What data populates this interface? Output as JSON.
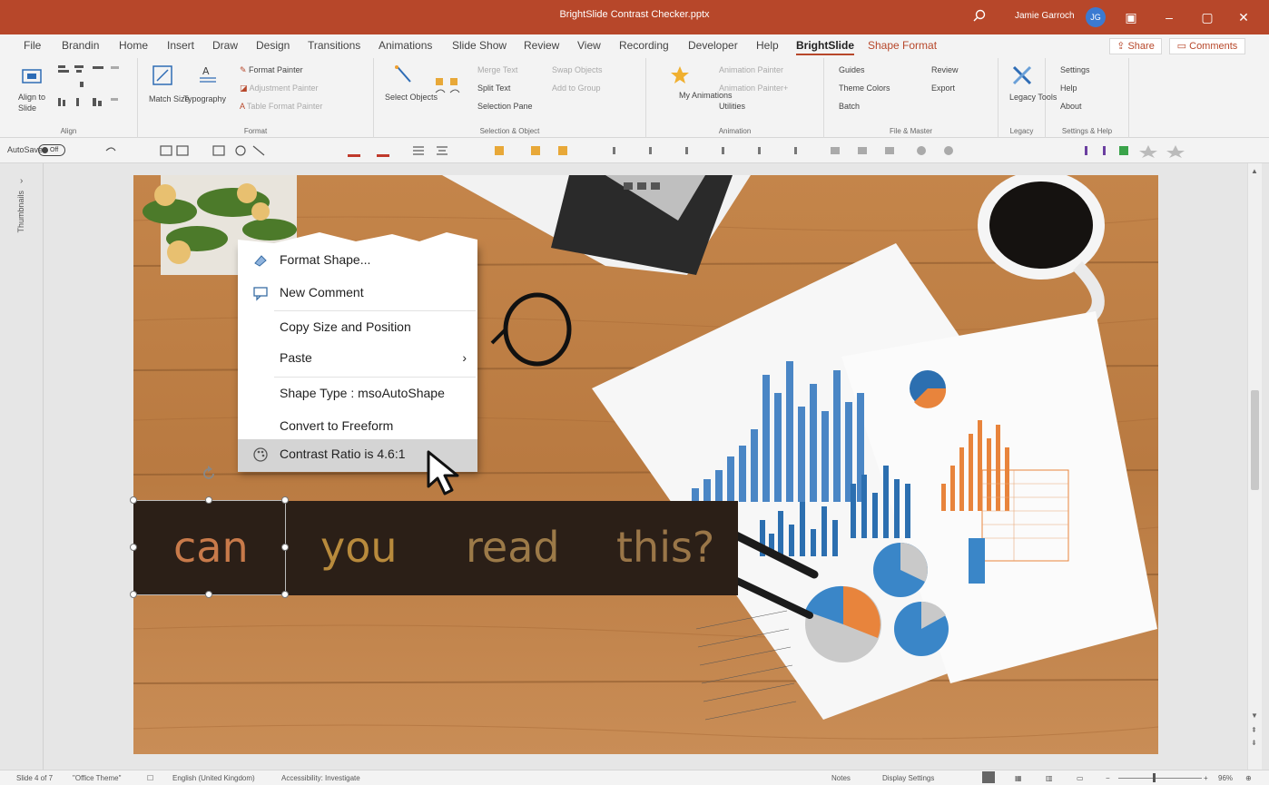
{
  "app": {
    "title": "BrightSlide Contrast Checker.pptx",
    "user_name": "Jamie Garroch",
    "user_initials": "JG"
  },
  "menu": {
    "tabs": [
      "File",
      "Brandin",
      "Home",
      "Insert",
      "Draw",
      "Design",
      "Transitions",
      "Animations",
      "Slide Show",
      "Review",
      "View",
      "Recording",
      "Developer",
      "Help",
      "BrightSlide",
      "Shape Format"
    ],
    "share": "Share",
    "comments": "Comments"
  },
  "ribbon": {
    "align": {
      "align_to": "Align to",
      "slide": "Slide",
      "name": "Align"
    },
    "format": {
      "match_size": "Match Size",
      "typography": "Typography",
      "format_painter": "Format Painter",
      "adjustment_painter": "Adjustment Painter",
      "table_format_painter": "Table Format Painter",
      "name": "Format"
    },
    "selection": {
      "select_objects": "Select Objects",
      "merge_text": "Merge Text",
      "swap_objects": "Swap Objects",
      "split_text": "Split Text",
      "add_to_group": "Add to Group",
      "selection_pane": "Selection Pane",
      "name": "Selection & Object"
    },
    "animation": {
      "my_animations": "My Animations",
      "animation_painter": "Animation Painter",
      "animation_painter_plus": "Animation Painter+",
      "utilities": "Utilities",
      "name": "Animation"
    },
    "file": {
      "guides": "Guides",
      "review": "Review",
      "theme_colors": "Theme Colors",
      "export": "Export",
      "batch": "Batch",
      "name": "File & Master"
    },
    "legacy": {
      "legacy_tools": "Legacy Tools",
      "name": "Legacy"
    },
    "settings": {
      "settings": "Settings",
      "help": "Help",
      "about": "About",
      "name": "Settings & Help"
    }
  },
  "qat": {
    "autosave": "AutoSave",
    "toggle": "Off"
  },
  "thumbnails_label": "Thumbnails",
  "slide": {
    "words": [
      "can",
      "you",
      "read",
      "this?"
    ],
    "word_colors": [
      "#c87a4a",
      "#b88a3c",
      "#9c7a48",
      "#9a7648"
    ],
    "box_color": "#2b1f17"
  },
  "context_menu": {
    "items": [
      {
        "label": "Format Shape...",
        "icon": "format-shape-icon"
      },
      {
        "label": "New Comment",
        "icon": "comment-icon"
      },
      {
        "label": "Copy Size and Position",
        "icon": ""
      },
      {
        "label": "Paste",
        "icon": ""
      },
      {
        "label": "Shape Type : msoAutoShape",
        "icon": ""
      },
      {
        "label": "Convert to Freeform",
        "icon": ""
      },
      {
        "label": "Contrast Ratio is 4.6:1",
        "icon": "palette-icon"
      }
    ]
  },
  "status": {
    "slide": "Slide 4 of 7",
    "theme": "\"Office Theme\"",
    "language": "English (United Kingdom)",
    "accessibility": "Accessibility: Investigate",
    "notes": "Notes",
    "display": "Display Settings",
    "zoom": "96%"
  }
}
